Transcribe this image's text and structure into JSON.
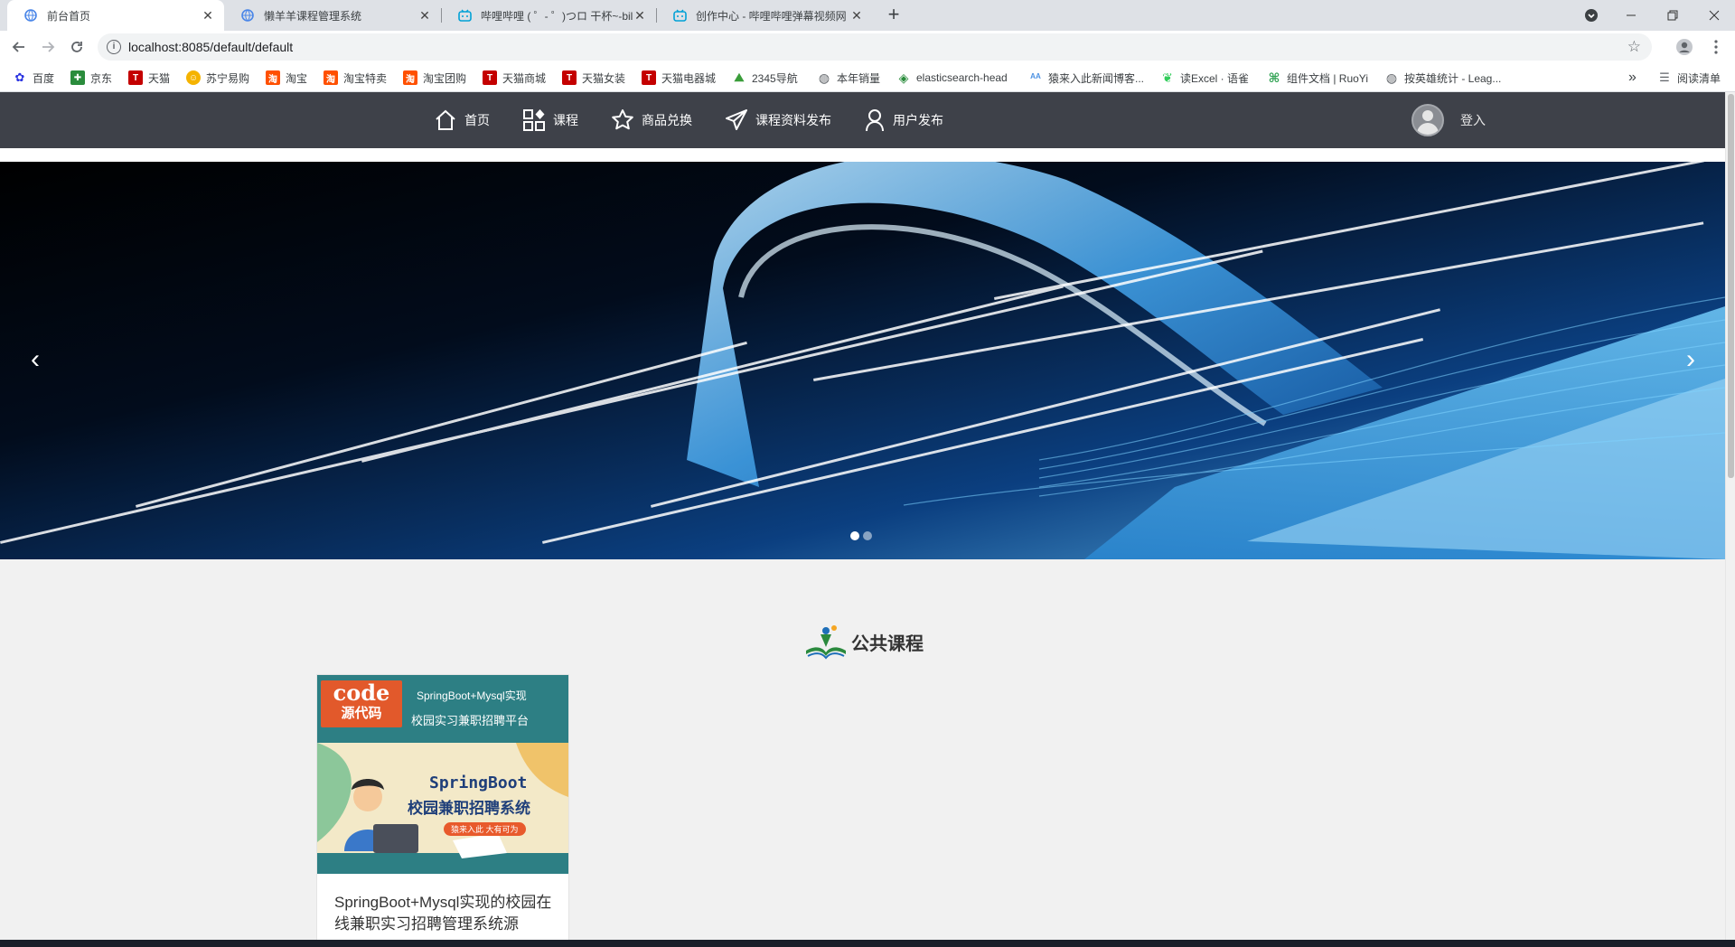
{
  "browser": {
    "tabs": [
      {
        "title": "前台首页",
        "active": true,
        "icon": "globe-icon"
      },
      {
        "title": "懒羊羊课程管理系统",
        "active": false,
        "icon": "globe-icon"
      },
      {
        "title": "哔哩哔哩 ( ゜- ゜)つロ 干杯~-bili",
        "active": false,
        "icon": "bilibili-icon"
      },
      {
        "title": "创作中心 - 哔哩哔哩弹幕视频网",
        "active": false,
        "icon": "bilibili-icon"
      }
    ],
    "new_tab": "+",
    "url": "localhost:8085/default/default",
    "bookmarks": [
      {
        "label": "百度",
        "icon": "baidu-icon",
        "color": "#2932e1"
      },
      {
        "label": "京东",
        "icon": "jd-icon",
        "color": "#2a8c3c"
      },
      {
        "label": "天猫",
        "icon": "tmall-icon",
        "color": "#c40000"
      },
      {
        "label": "苏宁易购",
        "icon": "suning-icon",
        "color": "#f5b300"
      },
      {
        "label": "淘宝",
        "icon": "taobao-icon",
        "color": "#ff5000"
      },
      {
        "label": "淘宝特卖",
        "icon": "taobao-icon",
        "color": "#ff5000"
      },
      {
        "label": "淘宝团购",
        "icon": "taobao-icon",
        "color": "#ff5000"
      },
      {
        "label": "天猫商城",
        "icon": "tmall-icon",
        "color": "#c40000"
      },
      {
        "label": "天猫女装",
        "icon": "tmall-icon",
        "color": "#c40000"
      },
      {
        "label": "天猫电器城",
        "icon": "tmall-icon",
        "color": "#c40000"
      },
      {
        "label": "2345导航",
        "icon": "nav-icon",
        "color": "#3a9d3a"
      },
      {
        "label": "本年销量",
        "icon": "globe-icon",
        "color": "#5f6368"
      },
      {
        "label": "elasticsearch-head",
        "icon": "es-icon",
        "color": "#2a8c3c"
      },
      {
        "label": "猿来入此新闻博客...",
        "icon": "blog-icon",
        "color": "#4a90e2"
      },
      {
        "label": "读Excel · 语雀",
        "icon": "yuque-icon",
        "color": "#31cc5a"
      },
      {
        "label": "组件文档 | RuoYi",
        "icon": "ruoyi-icon",
        "color": "#31a354"
      },
      {
        "label": "按英雄统计 - Leag...",
        "icon": "globe-icon",
        "color": "#5f6368"
      }
    ],
    "more": "»",
    "reading_list": "阅读清单"
  },
  "site": {
    "nav": [
      {
        "label": "首页",
        "icon": "home-icon"
      },
      {
        "label": "课程",
        "icon": "apps-icon"
      },
      {
        "label": "商品兑换",
        "icon": "star-icon"
      },
      {
        "label": "课程资料发布",
        "icon": "send-icon"
      },
      {
        "label": "用户发布",
        "icon": "user-icon"
      }
    ],
    "login": "登入",
    "carousel": {
      "slides": 2,
      "current": 1,
      "prev": "‹",
      "next": "›"
    },
    "section_title": "公共课程",
    "courses": [
      {
        "thumb_code": "code",
        "thumb_code_cn": "源代码",
        "thumb_top": "SpringBoot+Mysql实现",
        "thumb_sub": "校园实习兼职招聘平台",
        "thumb_poster_title": "SpringBoot",
        "thumb_poster_sub": "校园兼职招聘系统",
        "thumb_poster_tag": "猿来入此 大有可为",
        "title": "SpringBoot+Mysql实现的校园在线兼职实习招聘管理系统源"
      }
    ]
  },
  "colors": {
    "nav_bg": "#3e4149",
    "page_bg": "#f1f1f1",
    "thumb_bg": "#2d7f84"
  }
}
